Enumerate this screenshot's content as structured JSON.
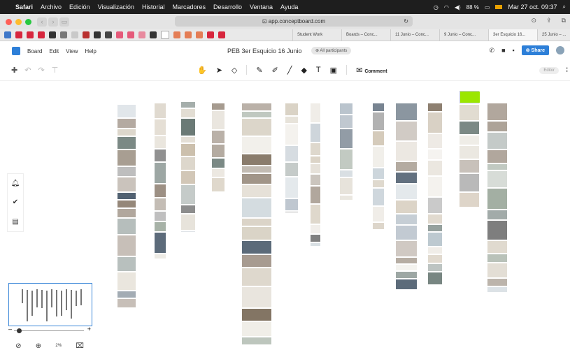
{
  "menubar": {
    "apple_icon": "apple-icon",
    "items": [
      "Safari",
      "Archivo",
      "Edición",
      "Visualización",
      "Historial",
      "Marcadores",
      "Desarrollo",
      "Ventana",
      "Ayuda"
    ],
    "battery": "88 %",
    "clock": "Mar 27 oct.  09:37"
  },
  "browser": {
    "url": "app.conceptboard.com",
    "tabs": [
      "Student Work",
      "Boards – Conc...",
      "11 Junio – Conc...",
      "9 Junio – Conc...",
      "3er Esquicio 16...",
      "25 Junio – ..."
    ]
  },
  "app": {
    "menu": [
      "Board",
      "Edit",
      "View",
      "Help"
    ],
    "board_title": "PEB 3er Esquicio 16 Junio",
    "participants": "All participants",
    "share_label": "Share",
    "editor_label": "Editor"
  },
  "toolbar": {
    "comment_label": "Comment",
    "tools": [
      "hand-icon",
      "pointer-icon",
      "eraser-icon",
      "pen-icon",
      "marker-icon",
      "line-icon",
      "shapes-icon",
      "text-icon",
      "sticky-note-icon",
      "comment-icon"
    ]
  },
  "zoom": {
    "level": "2%"
  },
  "colors": {
    "accent": "#2d7fd8",
    "menubar_bg": "#1e1e1e",
    "highlight": "#9be600"
  }
}
